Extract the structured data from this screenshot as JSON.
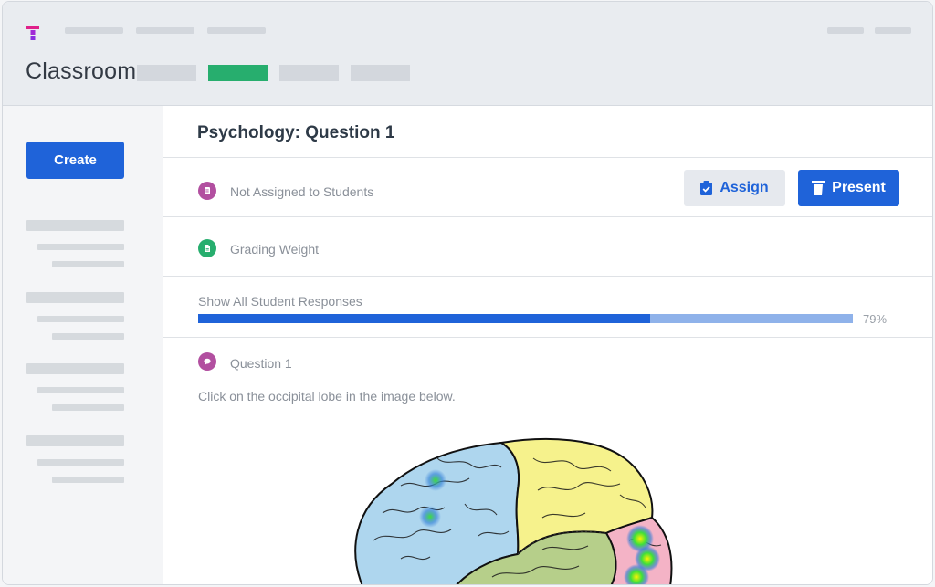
{
  "header": {
    "title": "Classroom",
    "nav_placeholders": [
      "",
      "",
      "",
      ""
    ],
    "accent_color": "#27ae6e",
    "logo_colors": [
      "#e0208a",
      "#8b2ee0"
    ]
  },
  "sidebar": {
    "create_label": "Create"
  },
  "main": {
    "question_title": "Psychology: Question 1",
    "status_label": "Not Assigned to Students",
    "assign_label": "Assign",
    "present_label": "Present",
    "grading_label": "Grading Weight",
    "responses_label": "Show All Student Responses",
    "progress_percent": 79,
    "progress_fill_fraction": 0.69,
    "progress_text": "79%",
    "question_label": "Question 1",
    "prompt": "Click on the occipital lobe in the image below.",
    "icons": {
      "status": "clipboard-icon",
      "grading": "document-icon",
      "question": "speech-bubble-icon",
      "assign": "clipboard-check-icon",
      "present": "podium-icon"
    },
    "colors": {
      "primary": "#1f63d9",
      "status_icon": "#b24fa0",
      "grading_icon": "#27ae6e",
      "question_icon": "#b24fa0"
    }
  },
  "image": {
    "subject": "brain-lobes-heatmap",
    "lobe_colors": [
      "#aed6ee",
      "#f6f28c",
      "#f4b3c6",
      "#b6cf8a"
    ]
  }
}
